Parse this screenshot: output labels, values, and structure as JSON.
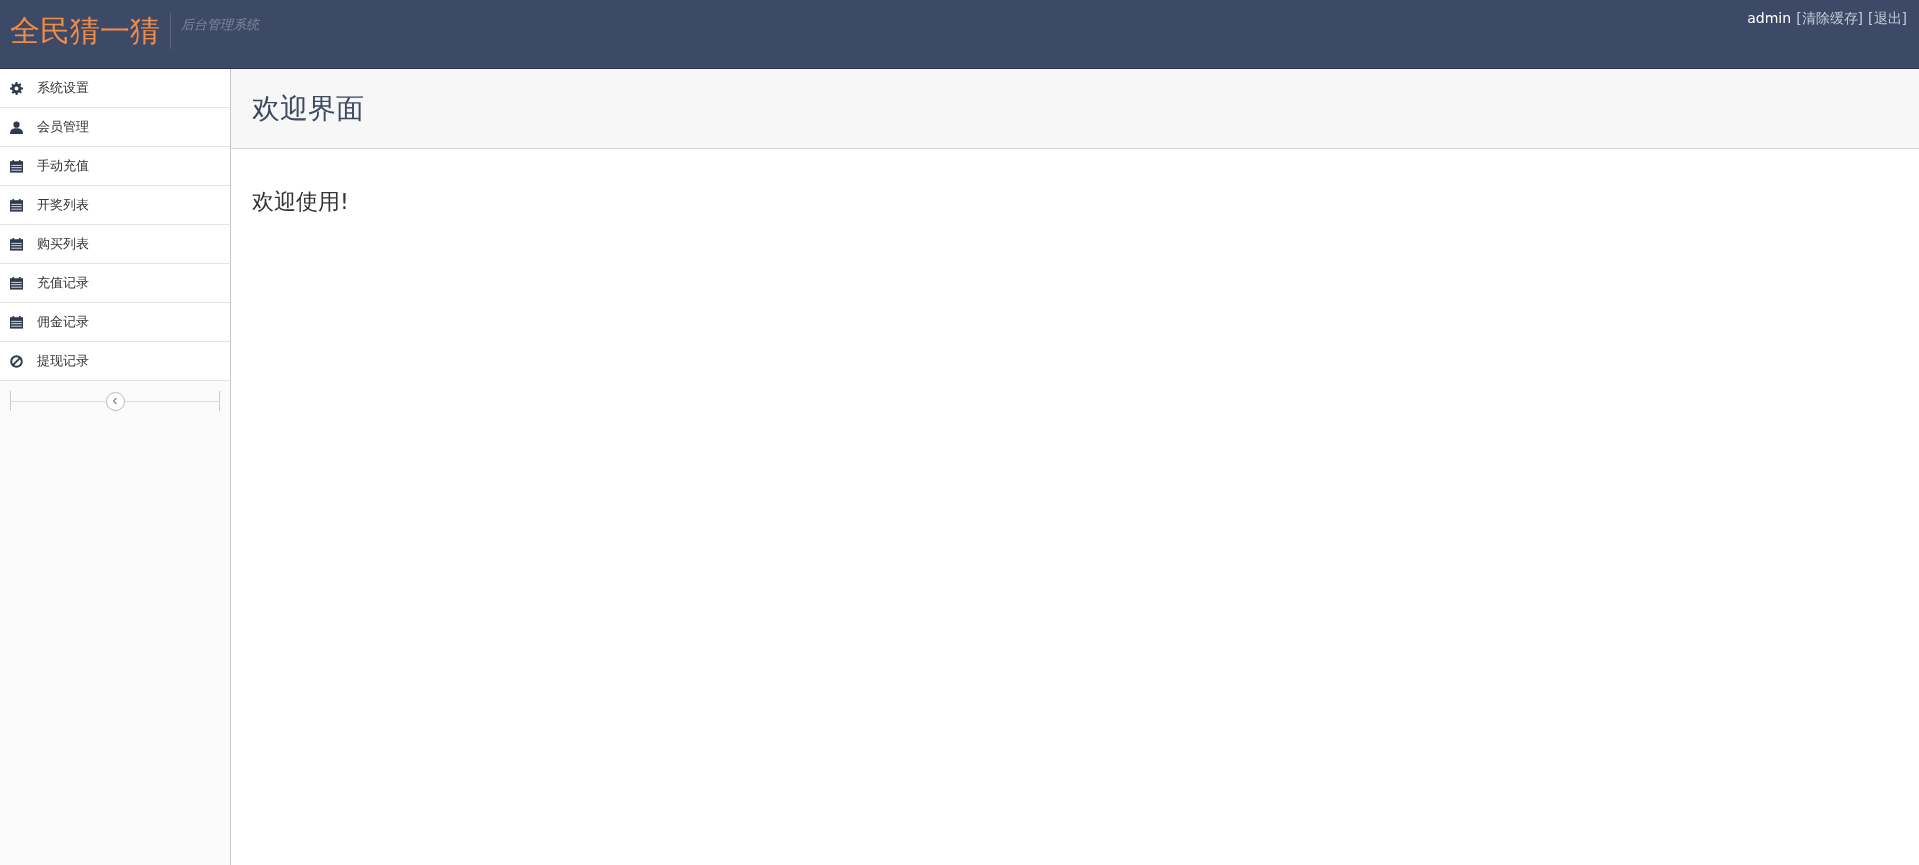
{
  "header": {
    "logo": "全民猜一猜",
    "subtitle": "后台管理系统",
    "user": "admin",
    "links": [
      "[清除缓存]",
      "[退出]"
    ]
  },
  "sidebar": {
    "items": [
      {
        "label": "系统设置",
        "kind": "gear"
      },
      {
        "label": "会员管理",
        "kind": "user"
      },
      {
        "label": "手动充值",
        "kind": "calendar"
      },
      {
        "label": "开奖列表",
        "kind": "calendar"
      },
      {
        "label": "购买列表",
        "kind": "calendar"
      },
      {
        "label": "充值记录",
        "kind": "calendar"
      },
      {
        "label": "佣金记录",
        "kind": "calendar"
      },
      {
        "label": "提现记录",
        "kind": "ban"
      }
    ]
  },
  "page": {
    "title": "欢迎界面",
    "message": "欢迎使用!"
  }
}
